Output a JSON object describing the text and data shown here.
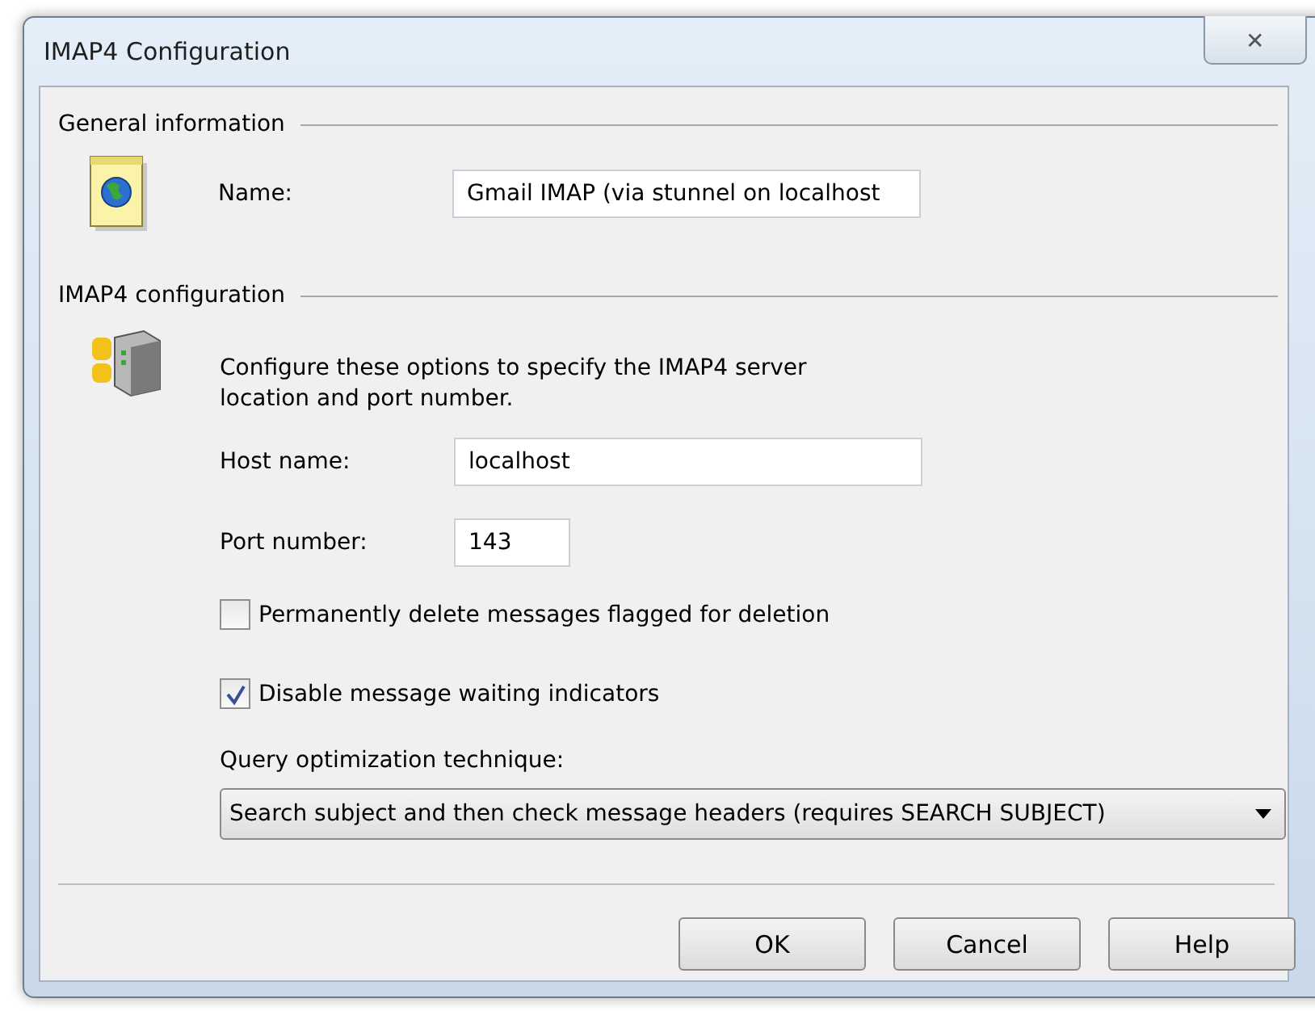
{
  "window": {
    "title": "IMAP4 Configuration",
    "close": "✕"
  },
  "general": {
    "heading": "General information",
    "name_label": "Name:",
    "name_value": "Gmail IMAP (via stunnel on localhost"
  },
  "imap": {
    "heading": "IMAP4 configuration",
    "description": "Configure these options to specify the IMAP4 server location and port number.",
    "host_label": "Host name:",
    "host_value": "localhost",
    "port_label": "Port number:",
    "port_value": "143"
  },
  "checkboxes": [
    {
      "label": "Permanently delete messages flagged for deletion",
      "checked": false
    },
    {
      "label": "Disable message waiting indicators",
      "checked": true
    }
  ],
  "query": {
    "label": "Query optimization technique:",
    "value": "Search subject and then check message headers (requires SEARCH SUBJECT)"
  },
  "buttons": [
    "OK",
    "Cancel",
    "Help"
  ]
}
